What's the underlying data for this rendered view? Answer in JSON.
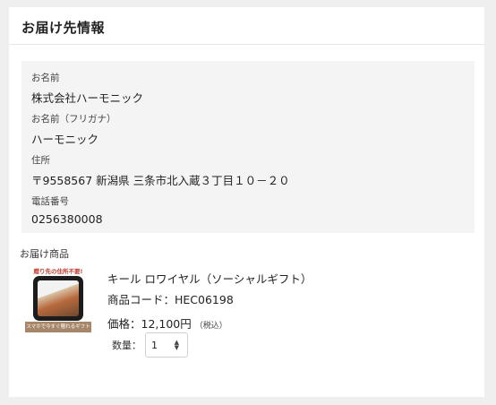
{
  "header": {
    "title": "お届け先情報"
  },
  "recipient": {
    "name_label": "お名前",
    "name_value": "株式会社ハーモニック",
    "kana_label": "お名前（フリガナ）",
    "kana_value": "ハーモニック",
    "address_label": "住所",
    "address_value": "〒9558567 新潟県 三条市北入蔵３丁目１０－２０",
    "phone_label": "電話番号",
    "phone_value": "0256380008"
  },
  "products": {
    "section_label": "お届け商品",
    "item": {
      "thumb_top_text": "贈り先の住所不要!",
      "thumb_bottom_text": "スマホで今すぐ贈れるギフト",
      "name": "キール ロワイヤル（ソーシャルギフト）",
      "code": "商品コード：HEC06198",
      "price": "価格：12,100円",
      "tax_note": "（税込）",
      "qty_label": "数量：",
      "qty_value": "1"
    }
  }
}
